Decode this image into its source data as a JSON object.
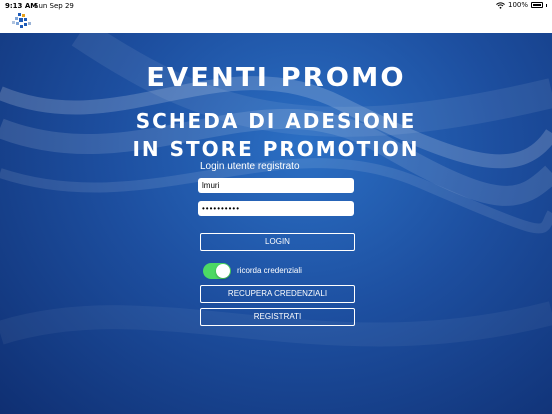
{
  "status_bar": {
    "time": "9:13 AM",
    "date": "Sun Sep 29",
    "battery": "100%",
    "wifi_icon": "wifi-icon",
    "battery_icon": "battery-icon"
  },
  "header": {
    "logo_icon": "app-logo-icon"
  },
  "main": {
    "title": "EVENTI PROMO",
    "subtitle_line1": "SCHEDA DI ADESIONE",
    "subtitle_line2": "IN STORE PROMOTION",
    "login_label": "Login utente registrato",
    "username_value": "lmuri",
    "password_value": "••••••••••",
    "login_button": "LOGIN",
    "remember_label": "ricorda credenziali",
    "remember_on": true,
    "recover_button": "RECUPERA CREDENZIALI",
    "register_button": "REGISTRATI"
  },
  "colors": {
    "background_center": "#2b6fc4",
    "background_edge": "#0f2f72",
    "toggle_on": "#4cd964"
  }
}
